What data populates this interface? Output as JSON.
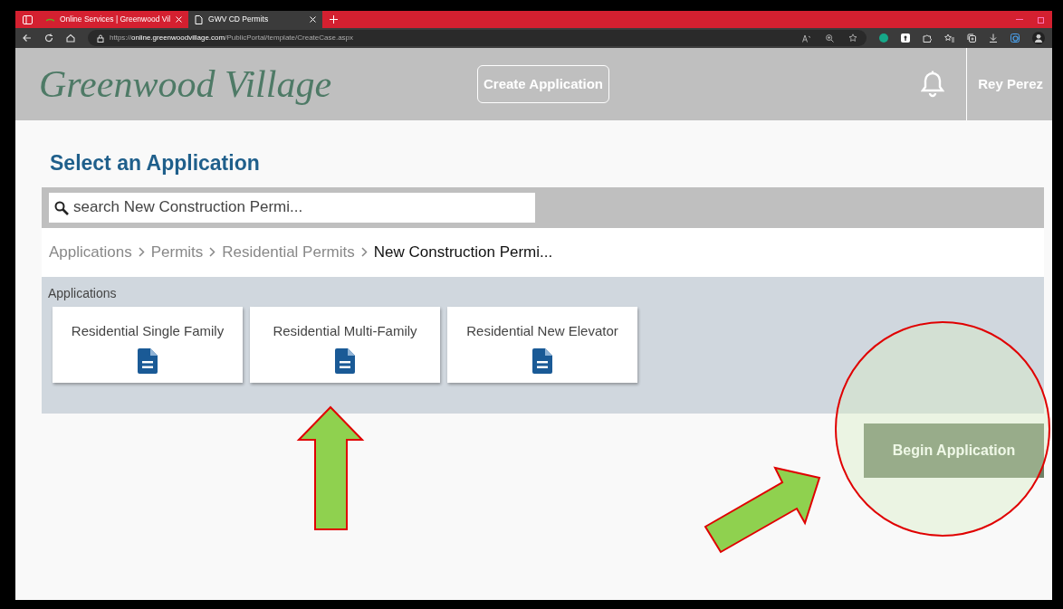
{
  "browser": {
    "tabs": [
      {
        "label": "Online Services | Greenwood Vil",
        "selected": false
      },
      {
        "label": "GWV CD Permits",
        "selected": true
      }
    ],
    "url": "https://**online.greenwoodvillage.com**/PublicPortal/template/CreateCase.aspx"
  },
  "header": {
    "logo": "Greenwood Village",
    "create_button": "Create Application",
    "user": "Rey Perez"
  },
  "page": {
    "title": "Select an Application",
    "search": {
      "placeholder": "search New Construction Permi..."
    },
    "breadcrumb": [
      {
        "label": "Applications",
        "current": false
      },
      {
        "label": "Permits",
        "current": false
      },
      {
        "label": "Residential Permits",
        "current": false
      },
      {
        "label": "New Construction Permi...",
        "current": true
      }
    ],
    "section_label": "Applications",
    "cards": [
      {
        "label": "Residential Single Family"
      },
      {
        "label": "Residential Multi-Family"
      },
      {
        "label": "Residential New Elevator"
      }
    ],
    "begin_button": {
      "label": "Begin Application",
      "disabled": true
    }
  }
}
